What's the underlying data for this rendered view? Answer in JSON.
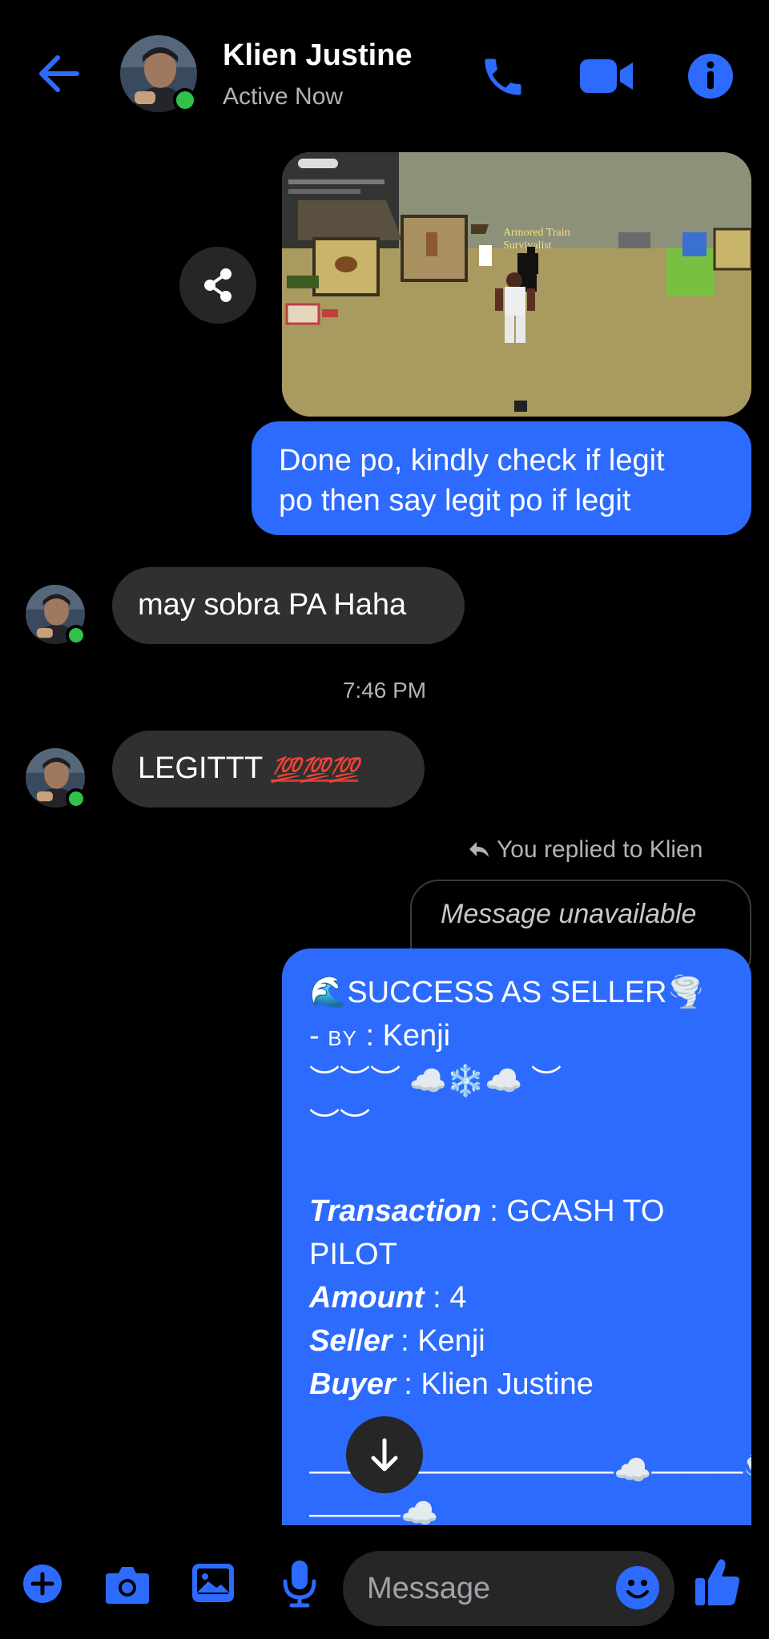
{
  "header": {
    "name": "Klien Justine",
    "status": "Active Now"
  },
  "messages": {
    "outgoing_1": {
      "line1": "Done po, kindly check if legit",
      "line2": "po then say legit po if legit"
    },
    "incoming_1": "may sobra PA Haha",
    "timestamp": "7:46 PM",
    "incoming_2": {
      "text": "LEGITTT ",
      "emoji": "💯💯💯"
    },
    "reply_indicator": "You replied to Klien",
    "unavailable": "Message unavailable",
    "seller": {
      "title": "🌊SUCCESS AS SELLER🌪️",
      "by_prefix": "- ",
      "by_label": "BY",
      "by_value": " : Kenji",
      "deco1": "︶︶︶ ☁️❄️☁️ ︶",
      "deco2": "︶︶",
      "transaction_label": "Transaction",
      "transaction_value": " : GCASH TO",
      "transaction_value2": "PILOT",
      "amount_label": "Amount",
      "amount_value": " : 4",
      "seller_label": "Seller",
      "seller_value": " : Kenji",
      "buyer_label": "Buyer",
      "buyer_value": " : Klien Justine",
      "divider1": "——————————☁️———🌪️",
      "divider2": "———☁️"
    }
  },
  "shared_photo": {
    "sign_text": "Armored Train",
    "sign_text2": "Survivalist"
  },
  "composer": {
    "placeholder": "Message"
  },
  "colors": {
    "accent": "#2d6bff",
    "incoming_bubble": "#303030",
    "online": "#31c24a"
  }
}
